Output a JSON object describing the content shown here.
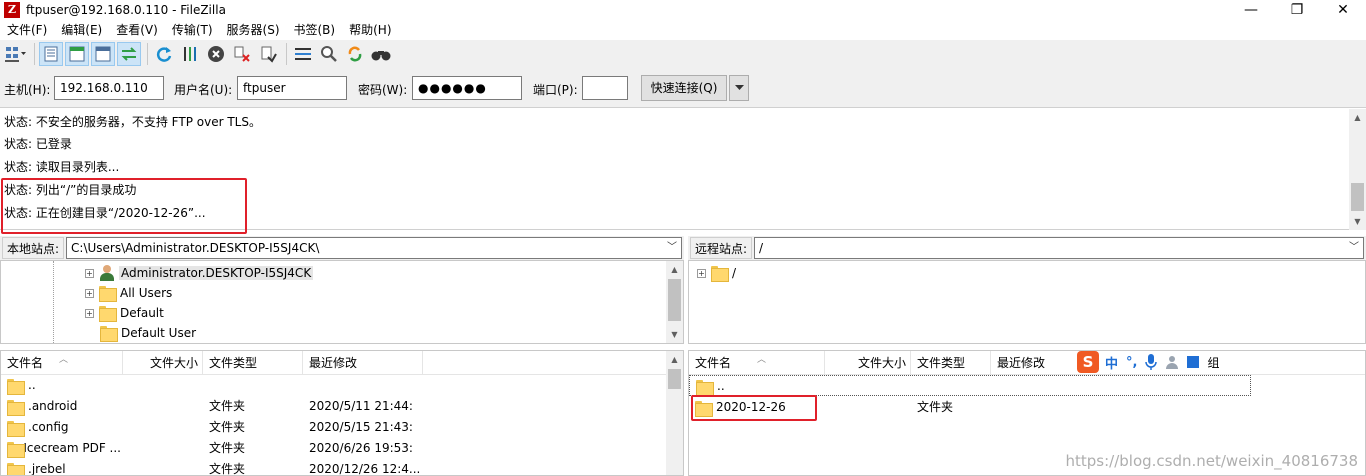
{
  "window": {
    "title": "ftpuser@192.168.0.110 - FileZilla",
    "app_icon": "Z",
    "controls": {
      "minimize": "—",
      "restore": "❐",
      "close": "✕"
    }
  },
  "menu": [
    {
      "label": "文件(F)"
    },
    {
      "label": "编辑(E)"
    },
    {
      "label": "查看(V)"
    },
    {
      "label": "传输(T)"
    },
    {
      "label": "服务器(S)"
    },
    {
      "label": "书签(B)"
    },
    {
      "label": "帮助(H)"
    }
  ],
  "quickconnect": {
    "host_label": "主机(H):",
    "host_value": "192.168.0.110",
    "user_label": "用户名(U):",
    "user_value": "ftpuser",
    "pass_label": "密码(W):",
    "pass_value": "●●●●●●",
    "port_label": "端口(P):",
    "port_value": "",
    "connect_label": "快速连接(Q)"
  },
  "log": [
    "状态: 不安全的服务器，不支持 FTP over TLS。",
    "状态: 已登录",
    "状态: 读取目录列表...",
    "状态: 列出“/”的目录成功",
    "状态: 正在创建目录“/2020-12-26”..."
  ],
  "local": {
    "site_label": "本地站点:",
    "path": "C:\\Users\\Administrator.DESKTOP-I5SJ4CK\\",
    "tree": [
      {
        "label": "Administrator.DESKTOP-I5SJ4CK",
        "icon": "user-icon",
        "expander": "+"
      },
      {
        "label": "All Users",
        "icon": "folder-icon",
        "expander": "+"
      },
      {
        "label": "Default",
        "icon": "folder-icon",
        "expander": "+"
      },
      {
        "label": "Default User",
        "icon": "folder-icon",
        "expander": ""
      }
    ],
    "columns": {
      "name": "文件名",
      "size": "文件大小",
      "type": "文件类型",
      "modified": "最近修改"
    },
    "files": [
      {
        "name": "..",
        "size": "",
        "type": "",
        "modified": ""
      },
      {
        "name": ".android",
        "size": "",
        "type": "文件夹",
        "modified": "2020/5/11 21:44:"
      },
      {
        "name": ".config",
        "size": "",
        "type": "文件夹",
        "modified": "2020/5/15 21:43:"
      },
      {
        "name": ".Icecream PDF ...",
        "size": "",
        "type": "文件夹",
        "modified": "2020/6/26 19:53:"
      },
      {
        "name": ".jrebel",
        "size": "",
        "type": "文件夹",
        "modified": "2020/12/26 12:4..."
      }
    ]
  },
  "remote": {
    "site_label": "远程站点:",
    "path": "/",
    "tree": [
      {
        "label": "/",
        "icon": "folder-icon",
        "expander": "+"
      }
    ],
    "columns": {
      "name": "文件名",
      "size": "文件大小",
      "type": "文件类型",
      "modified": "最近修改"
    },
    "files": [
      {
        "name": "..",
        "size": "",
        "type": "",
        "modified": ""
      },
      {
        "name": "2020-12-26",
        "size": "",
        "type": "文件夹",
        "modified": ""
      }
    ]
  },
  "ime": {
    "logo": "S",
    "lang": "中",
    "punct": "°,",
    "extra": "组"
  },
  "watermark": "https://blog.csdn.net/weixin_40816738",
  "colors": {
    "highlight": "#e0202a",
    "folder": "#ffd86e",
    "toolbar_bg": "#f0f0f0"
  }
}
